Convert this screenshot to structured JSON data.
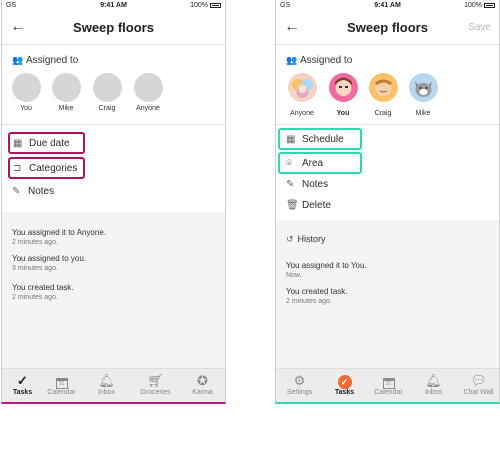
{
  "status": {
    "carrier": "GS",
    "time": "9:41 AM",
    "battery": "100%"
  },
  "left": {
    "title": "Sweep floors",
    "assigned_label": "Assigned to",
    "avatars": [
      {
        "name": "You"
      },
      {
        "name": "Mike"
      },
      {
        "name": "Craig"
      },
      {
        "name": "Anyone"
      }
    ],
    "rows": [
      "Due date",
      "Categories",
      "Notes"
    ],
    "history": [
      {
        "text": "You assigned it to Anyone.",
        "time": "2 minutes ago."
      },
      {
        "text": "You assigned to you.",
        "time": "3 minutes ago."
      },
      {
        "text": "You created task.",
        "time": "2 minutes ago."
      }
    ],
    "tabs": [
      "Tasks",
      "Calendar",
      "Inbox",
      "Groceries",
      "Karma"
    ]
  },
  "right": {
    "title": "Sweep floors",
    "save": "Save",
    "assigned_label": "Assigned to",
    "avatars": [
      {
        "name": "Anyone"
      },
      {
        "name": "You"
      },
      {
        "name": "Craig"
      },
      {
        "name": "Mike"
      }
    ],
    "rows": [
      "Schedule",
      "Area",
      "Notes",
      "Delete"
    ],
    "history_title": "History",
    "history": [
      {
        "text": "You assigned it to You.",
        "time": "Now."
      },
      {
        "text": "You created task.",
        "time": "2 minutes ago."
      }
    ],
    "tabs": [
      "Settings",
      "Tasks",
      "Calendar",
      "Inbox",
      "Chat Wall"
    ]
  },
  "colors": {
    "before_accent": "#c0177a",
    "after_accent": "#2fd9b0",
    "active_tab": "#f06a33"
  }
}
